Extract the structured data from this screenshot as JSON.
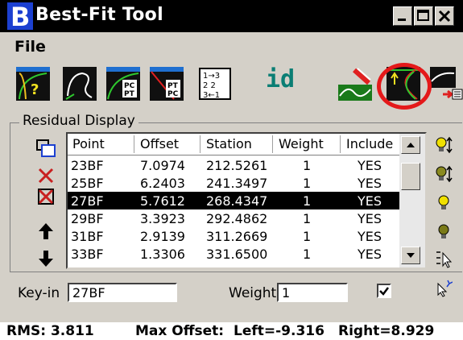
{
  "window": {
    "title": "Best-Fit Tool"
  },
  "menu": {
    "file": "File"
  },
  "toolbar": {
    "id_label": "id"
  },
  "residual": {
    "group_label": "Residual Display",
    "columns": [
      "Point",
      "Offset",
      "Station",
      "Weight",
      "Include"
    ],
    "rows": [
      [
        "23BF",
        "7.0974",
        "212.5261",
        "1",
        "YES"
      ],
      [
        "25BF",
        "6.2403",
        "241.3497",
        "1",
        "YES"
      ],
      [
        "27BF",
        "5.7612",
        "268.4347",
        "1",
        "YES"
      ],
      [
        "29BF",
        "3.3923",
        "292.4862",
        "1",
        "YES"
      ],
      [
        "31BF",
        "2.9139",
        "311.2669",
        "1",
        "YES"
      ],
      [
        "33BF",
        "1.3306",
        "331.6500",
        "1",
        "YES"
      ]
    ],
    "selected_row": "27BF"
  },
  "keyin": {
    "label": "Key-in",
    "value": "27BF"
  },
  "weight": {
    "label": "Weight",
    "value": "1",
    "checked": true
  },
  "status": {
    "rms": "RMS: 3.811",
    "max_offset": "Max Offset:",
    "left": "Left=-9.316",
    "right": "Right=8.929"
  },
  "colors": {
    "highlight_ring": "#e4191a",
    "id_text": "#0a7e74",
    "selection_bg": "#000000"
  }
}
